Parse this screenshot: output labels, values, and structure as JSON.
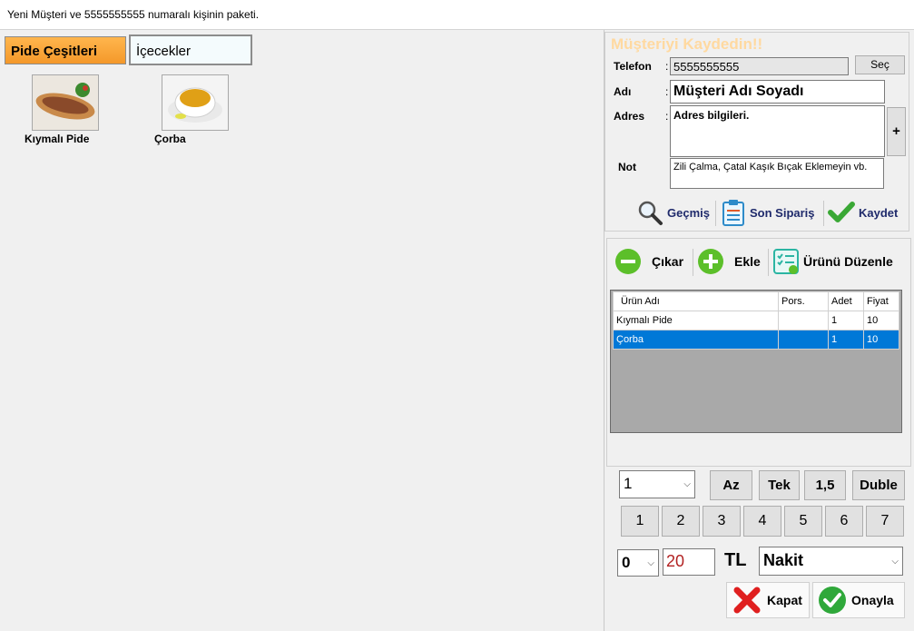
{
  "window": {
    "title": "Yeni Müşteri ve 5555555555 numaralı kişinin paketi."
  },
  "categories": {
    "active": "Pide Çeşitleri",
    "inactive": "İçecekler"
  },
  "products": [
    {
      "label": "Kıymalı Pide"
    },
    {
      "label": "Çorba"
    }
  ],
  "customer": {
    "header": "Müşteriyi Kaydedin!!",
    "phone_label": "Telefon",
    "phone_value": "5555555555",
    "select_label": "Seç",
    "name_label": "Adı",
    "name_value": "Müşteri Adı Soyadı",
    "address_label": "Adres",
    "address_value": "Adres bilgileri.",
    "add_label": "+",
    "note_label": "Not",
    "note_value": "Zili Çalma, Çatal Kaşık Bıçak Eklemeyin vb.",
    "colon": ":",
    "history_label": "Geçmiş",
    "last_order_label": "Son Sipariş",
    "save_label": "Kaydet"
  },
  "order_tools": {
    "remove_label": "Çıkar",
    "add_label": "Ekle",
    "edit_label": "Ürünü Düzenle"
  },
  "grid": {
    "headers": [
      "Ürün Adı",
      "Pors.",
      "Adet",
      "Fiyat"
    ],
    "rows": [
      [
        "Kıymalı Pide",
        "",
        "1",
        "10"
      ],
      [
        "Çorba",
        "",
        "1",
        "10"
      ]
    ],
    "selected_row": 1
  },
  "quantity": {
    "value": "1",
    "portions": [
      "Az",
      "Tek",
      "1,5",
      "Duble"
    ],
    "numbers": [
      "1",
      "2",
      "3",
      "4",
      "5",
      "6",
      "7"
    ]
  },
  "payment": {
    "discount": "0",
    "amount": "20",
    "currency": "TL",
    "method": "Nakit"
  },
  "footer": {
    "close_label": "Kapat",
    "confirm_label": "Onayla"
  },
  "colors": {
    "accent_orange": "#f4982a",
    "selection_blue": "#0078d7",
    "amount_red": "#b22222",
    "header_orange": "#ffd9a0"
  }
}
